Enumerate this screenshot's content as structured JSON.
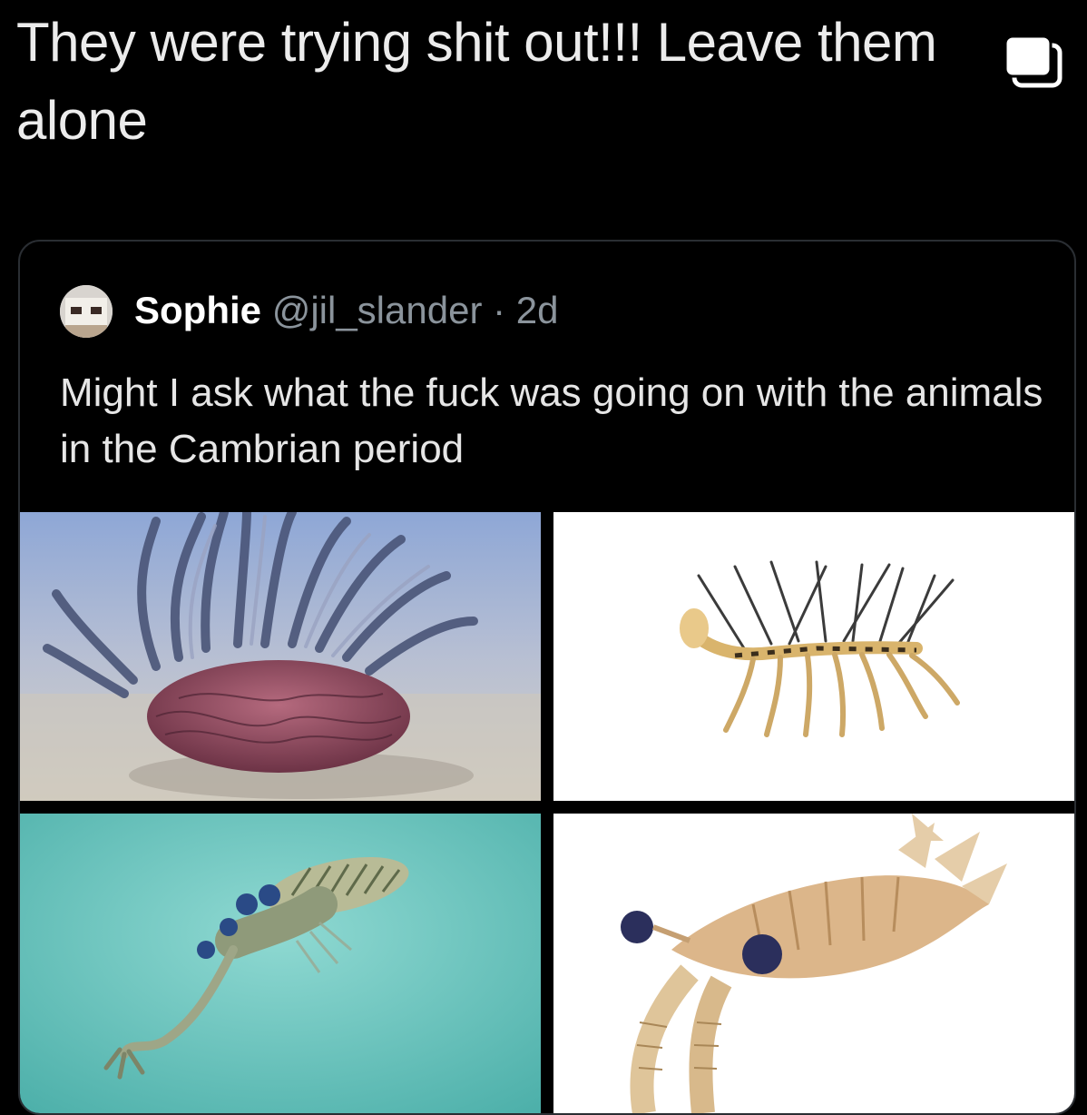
{
  "post": {
    "text": "They were trying shit out!!! Leave them alone",
    "copy_icon": "copy-icon"
  },
  "quote": {
    "avatar": "avatar",
    "name": "Sophie",
    "handle": "@jil_slander",
    "separator": "·",
    "time": "2d",
    "text": "Might I ask what the fuck was going on with the animals in the Cambrian period"
  },
  "images": [
    "wiwaxia",
    "hallucigenia",
    "opabinia",
    "anomalocaris"
  ],
  "colors": {
    "background": "#000000",
    "muted_text": "#8b949c",
    "card_border": "#2a2e33"
  }
}
